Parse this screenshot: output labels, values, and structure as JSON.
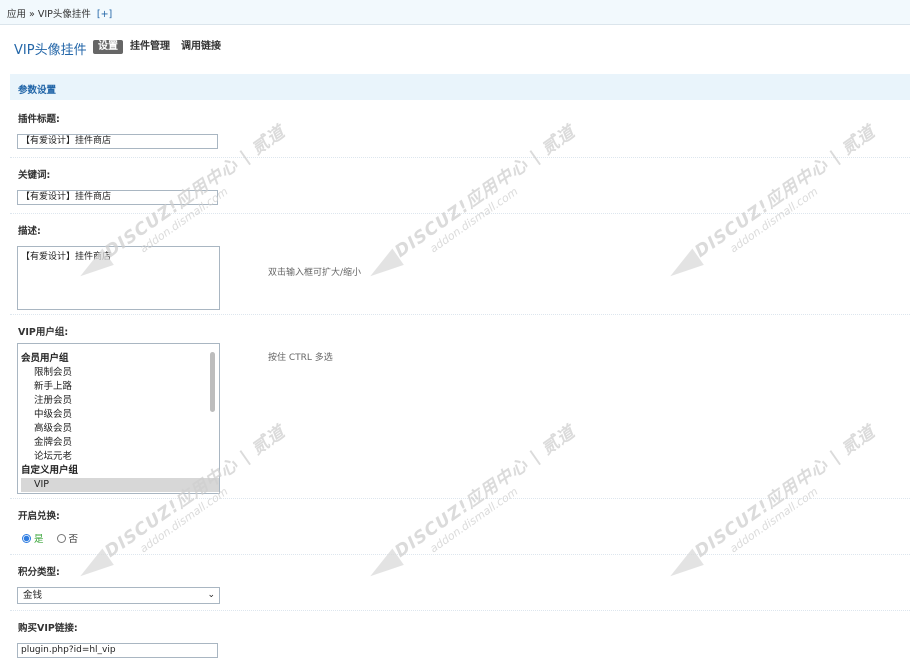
{
  "breadcrumb": {
    "path": "应用 » VIP头像挂件",
    "add": "[+]"
  },
  "header": {
    "plugin_title": "VIP头像挂件",
    "tabs": [
      {
        "label": "设置",
        "active": true
      },
      {
        "label": "挂件管理",
        "active": false
      },
      {
        "label": "调用链接",
        "active": false
      }
    ]
  },
  "section": {
    "title": "参数设置"
  },
  "fields": {
    "plugin_title": {
      "label": "插件标题:",
      "value": "【有爱设计】挂件商店"
    },
    "keywords": {
      "label": "关键词:",
      "value": "【有爱设计】挂件商店"
    },
    "description": {
      "label": "描述:",
      "value": "【有爱设计】挂件商店",
      "hint": "双击输入框可扩大/缩小"
    },
    "vip_groups": {
      "label": "VIP用户组:",
      "hint": "按住 CTRL 多选",
      "options": [
        {
          "text": "会员用户组",
          "type": "group"
        },
        {
          "text": "限制会员",
          "type": "child"
        },
        {
          "text": "新手上路",
          "type": "child"
        },
        {
          "text": "注册会员",
          "type": "child"
        },
        {
          "text": "中级会员",
          "type": "child"
        },
        {
          "text": "高级会员",
          "type": "child"
        },
        {
          "text": "金牌会员",
          "type": "child"
        },
        {
          "text": "论坛元老",
          "type": "child"
        },
        {
          "text": "自定义用户组",
          "type": "group"
        },
        {
          "text": "VIP",
          "type": "child",
          "selected": true
        }
      ]
    },
    "enable_exchange": {
      "label": "开启兑换:",
      "yes": "是",
      "no": "否",
      "value": "是"
    },
    "credit_type": {
      "label": "积分类型:",
      "value": "金钱"
    },
    "buy_vip_link": {
      "label": "购买VIP链接:",
      "value": "plugin.php?id=hl_vip"
    }
  },
  "watermark": {
    "line1": "DISCUZ!应用中心 | 贰道",
    "line2": "addon.dismall.com"
  },
  "colors": {
    "accent": "#2366a8",
    "section_bg": "#e9f4fb",
    "tab_active_bg": "#666666"
  }
}
